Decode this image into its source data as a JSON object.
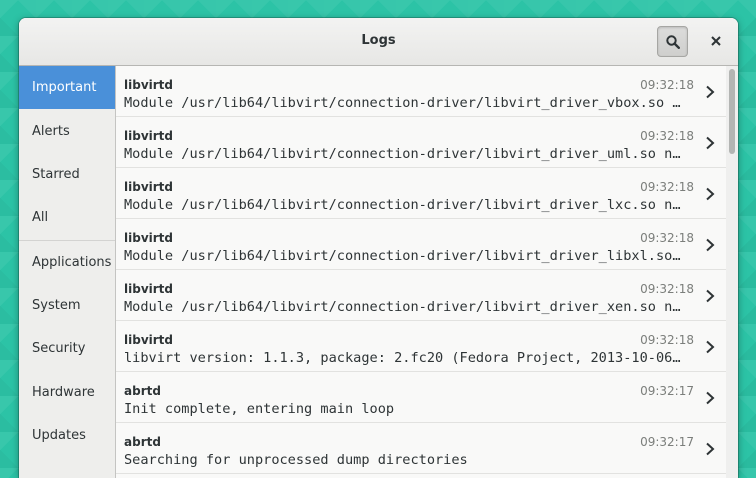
{
  "window": {
    "title": "Logs"
  },
  "header": {
    "search_icon": "search-icon",
    "close_icon": "close-icon"
  },
  "sidebar": {
    "items": [
      {
        "label": "Important",
        "selected": true
      },
      {
        "label": "Alerts"
      },
      {
        "label": "Starred"
      },
      {
        "label": "All"
      },
      {
        "label": "Applications"
      },
      {
        "label": "System"
      },
      {
        "label": "Security"
      },
      {
        "label": "Hardware"
      },
      {
        "label": "Updates"
      }
    ],
    "accent": "#4a90d9"
  },
  "logs": [
    {
      "process": "libvirtd",
      "time": "09:32:18",
      "message": "Module /usr/lib64/libvirt/connection-driver/libvirt_driver_vbox.so …"
    },
    {
      "process": "libvirtd",
      "time": "09:32:18",
      "message": "Module /usr/lib64/libvirt/connection-driver/libvirt_driver_uml.so n…"
    },
    {
      "process": "libvirtd",
      "time": "09:32:18",
      "message": "Module /usr/lib64/libvirt/connection-driver/libvirt_driver_lxc.so n…"
    },
    {
      "process": "libvirtd",
      "time": "09:32:18",
      "message": "Module /usr/lib64/libvirt/connection-driver/libvirt_driver_libxl.so…"
    },
    {
      "process": "libvirtd",
      "time": "09:32:18",
      "message": "Module /usr/lib64/libvirt/connection-driver/libvirt_driver_xen.so n…"
    },
    {
      "process": "libvirtd",
      "time": "09:32:18",
      "message": "libvirt version: 1.1.3, package: 2.fc20 (Fedora Project, 2013-10-06…"
    },
    {
      "process": "abrtd",
      "time": "09:32:17",
      "message": "Init complete, entering main loop"
    },
    {
      "process": "abrtd",
      "time": "09:32:17",
      "message": "Searching for unprocessed dump directories"
    }
  ]
}
